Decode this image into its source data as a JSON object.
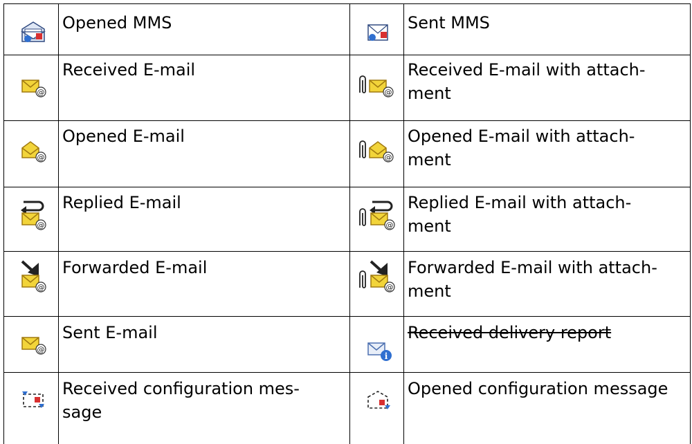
{
  "rows": [
    {
      "left": {
        "icon": "opened-mms-icon",
        "label": "Opened MMS"
      },
      "right": {
        "icon": "sent-mms-icon",
        "label": "Sent MMS"
      }
    },
    {
      "left": {
        "icon": "received-email-icon",
        "label": "Received E-mail"
      },
      "right": {
        "icon": "received-email-attachment-icon",
        "label": "Received E-mail with attach-\nment"
      }
    },
    {
      "left": {
        "icon": "opened-email-icon",
        "label": "Opened E-mail"
      },
      "right": {
        "icon": "opened-email-attachment-icon",
        "label": "Opened E-mail with attach-\nment"
      }
    },
    {
      "left": {
        "icon": "replied-email-icon",
        "label": "Replied E-mail"
      },
      "right": {
        "icon": "replied-email-attachment-icon",
        "label": "Replied E-mail with attach-\nment"
      }
    },
    {
      "left": {
        "icon": "forwarded-email-icon",
        "label": "Forwarded E-mail"
      },
      "right": {
        "icon": "forwarded-email-attachment-icon",
        "label": "Forwarded E-mail with attach-\nment"
      }
    },
    {
      "left": {
        "icon": "sent-email-icon",
        "label": "Sent E-mail"
      },
      "right": {
        "icon": "delivery-report-icon",
        "label": "Received delivery report"
      }
    },
    {
      "left": {
        "icon": "received-config-icon",
        "label": "Received configuration mes-\nsage"
      },
      "right": {
        "icon": "opened-config-icon",
        "label": "Opened configuration message"
      }
    }
  ],
  "colors": {
    "envelope": "#f2d43a",
    "envelope_dark": "#a07a10",
    "blue": "#2f6fd0",
    "red": "#d83030",
    "line": "#000000"
  }
}
